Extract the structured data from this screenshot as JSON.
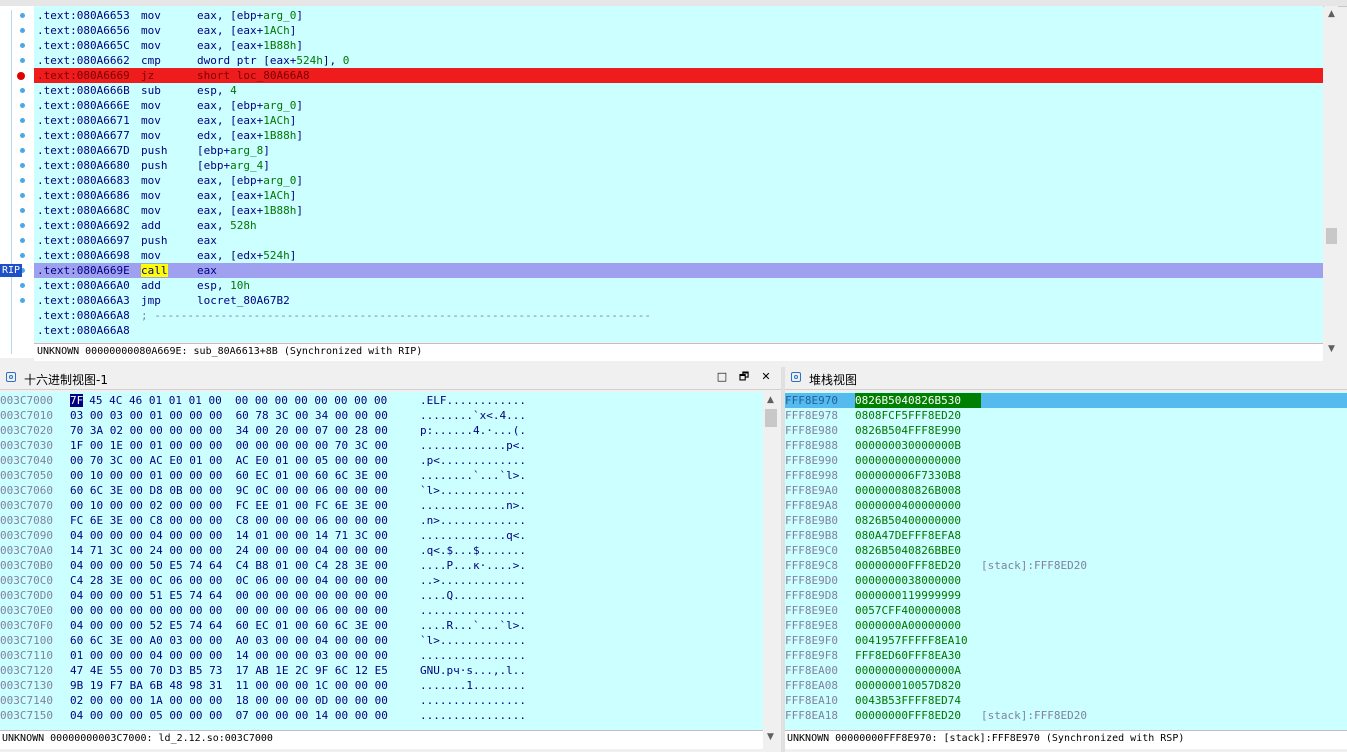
{
  "code_view": {
    "lines": [
      {
        "addr": ".text:080A6653",
        "mnem": "mov",
        "op": "eax, [ebp+arg_0]"
      },
      {
        "addr": ".text:080A6656",
        "mnem": "mov",
        "op": "eax, [eax+1ACh]"
      },
      {
        "addr": ".text:080A665C",
        "mnem": "mov",
        "op": "eax, [eax+1B88h]"
      },
      {
        "addr": ".text:080A6662",
        "mnem": "cmp",
        "op": "dword ptr [eax+524h], 0"
      },
      {
        "addr": ".text:080A6669",
        "mnem": "jz",
        "op": "short loc_80A66A8"
      },
      {
        "addr": ".text:080A666B",
        "mnem": "sub",
        "op": "esp, 4"
      },
      {
        "addr": ".text:080A666E",
        "mnem": "mov",
        "op": "eax, [ebp+arg_0]"
      },
      {
        "addr": ".text:080A6671",
        "mnem": "mov",
        "op": "eax, [eax+1ACh]"
      },
      {
        "addr": ".text:080A6677",
        "mnem": "mov",
        "op": "edx, [eax+1B88h]"
      },
      {
        "addr": ".text:080A667D",
        "mnem": "push",
        "op": "[ebp+arg_8]"
      },
      {
        "addr": ".text:080A6680",
        "mnem": "push",
        "op": "[ebp+arg_4]"
      },
      {
        "addr": ".text:080A6683",
        "mnem": "mov",
        "op": "eax, [ebp+arg_0]"
      },
      {
        "addr": ".text:080A6686",
        "mnem": "mov",
        "op": "eax, [eax+1ACh]"
      },
      {
        "addr": ".text:080A668C",
        "mnem": "mov",
        "op": "eax, [eax+1B88h]"
      },
      {
        "addr": ".text:080A6692",
        "mnem": "add",
        "op": "eax, 528h"
      },
      {
        "addr": ".text:080A6697",
        "mnem": "push",
        "op": "eax"
      },
      {
        "addr": ".text:080A6698",
        "mnem": "mov",
        "op": "eax, [edx+524h]"
      },
      {
        "addr": ".text:080A669E",
        "mnem": "call",
        "op": "eax"
      },
      {
        "addr": ".text:080A66A0",
        "mnem": "add",
        "op": "esp, 10h"
      },
      {
        "addr": ".text:080A66A3",
        "mnem": "jmp",
        "op": "locret_80A67B2"
      },
      {
        "addr": ".text:080A66A8",
        "mnem": "",
        "op": "",
        "comment": "; ---------------------------------------------------------------------------"
      },
      {
        "addr": ".text:080A66A8",
        "mnem": "",
        "op": ""
      }
    ],
    "rip_label": "RIP",
    "status": "UNKNOWN 00000000080A669E: sub_80A6613+8B (Synchronized with RIP)"
  },
  "hex_view": {
    "title": "十六进制视图-1",
    "rows": [
      {
        "addr": "003C7000",
        "bytes": "45 4C 46 01 01 01 00  00 00 00 00 00 00 00 00",
        "first": "7F",
        "ascii": ".ELF............"
      },
      {
        "addr": "003C7010",
        "bytes": "03 00 03 00 01 00 00 00  60 78 3C 00 34 00 00 00",
        "ascii": "........`x<.4..."
      },
      {
        "addr": "003C7020",
        "bytes": "70 3A 02 00 00 00 00 00  34 00 20 00 07 00 28 00",
        "ascii": "p:......4.·...(."
      },
      {
        "addr": "003C7030",
        "bytes": "1F 00 1E 00 01 00 00 00  00 00 00 00 00 70 3C 00",
        "ascii": ".............p<."
      },
      {
        "addr": "003C7040",
        "bytes": "00 70 3C 00 AC E0 01 00  AC E0 01 00 05 00 00 00",
        "ascii": ".p<............."
      },
      {
        "addr": "003C7050",
        "bytes": "00 10 00 00 01 00 00 00  60 EC 01 00 60 6C 3E 00",
        "ascii": "........`...`l>."
      },
      {
        "addr": "003C7060",
        "bytes": "60 6C 3E 00 D8 0B 00 00  9C 0C 00 00 06 00 00 00",
        "ascii": "`l>............."
      },
      {
        "addr": "003C7070",
        "bytes": "00 10 00 00 02 00 00 00  FC EE 01 00 FC 6E 3E 00",
        "ascii": ".............n>."
      },
      {
        "addr": "003C7080",
        "bytes": "FC 6E 3E 00 C8 00 00 00  C8 00 00 00 06 00 00 00",
        "ascii": ".n>............."
      },
      {
        "addr": "003C7090",
        "bytes": "04 00 00 00 04 00 00 00  14 01 00 00 14 71 3C 00",
        "ascii": ".............q<."
      },
      {
        "addr": "003C70A0",
        "bytes": "14 71 3C 00 24 00 00 00  24 00 00 00 04 00 00 00",
        "ascii": ".q<.$...$......."
      },
      {
        "addr": "003C70B0",
        "bytes": "04 00 00 00 50 E5 74 64  C4 B8 01 00 C4 28 3E 00",
        "ascii": "....P...к·....>."
      },
      {
        "addr": "003C70C0",
        "bytes": "C4 28 3E 00 0C 06 00 00  0C 06 00 00 04 00 00 00",
        "ascii": "..>............."
      },
      {
        "addr": "003C70D0",
        "bytes": "04 00 00 00 51 E5 74 64  00 00 00 00 00 00 00 00",
        "ascii": "....Q..........."
      },
      {
        "addr": "003C70E0",
        "bytes": "00 00 00 00 00 00 00 00  00 00 00 00 06 00 00 00",
        "ascii": "................"
      },
      {
        "addr": "003C70F0",
        "bytes": "04 00 00 00 52 E5 74 64  60 EC 01 00 60 6C 3E 00",
        "ascii": "....R...`...`l>."
      },
      {
        "addr": "003C7100",
        "bytes": "60 6C 3E 00 A0 03 00 00  A0 03 00 00 04 00 00 00",
        "ascii": "`l>............."
      },
      {
        "addr": "003C7110",
        "bytes": "01 00 00 00 04 00 00 00  14 00 00 00 03 00 00 00",
        "ascii": "................"
      },
      {
        "addr": "003C7120",
        "bytes": "47 4E 55 00 70 D3 B5 73  17 AB 1E 2C 9F 6C 12 E5",
        "ascii": "GNU.pч·s...,.l.."
      },
      {
        "addr": "003C7130",
        "bytes": "9B 19 F7 BA 6B 48 98 31  11 00 00 00 1C 00 00 00",
        "ascii": ".......1........"
      },
      {
        "addr": "003C7140",
        "bytes": "02 00 00 00 1A 00 00 00  18 00 00 00 0D 00 00 00",
        "ascii": "................"
      },
      {
        "addr": "003C7150",
        "bytes": "04 00 00 00 05 00 00 00  07 00 00 00 14 00 00 00",
        "ascii": "................"
      }
    ],
    "status": "UNKNOWN 00000000003C7000: ld_2.12.so:003C7000"
  },
  "stack_view": {
    "title": "堆栈视图",
    "rows": [
      {
        "addr": "FFF8E970",
        "val": "0826B5040826B530",
        "cmt": ""
      },
      {
        "addr": "FFF8E978",
        "val": "0808FCF5FFF8ED20",
        "cmt": ""
      },
      {
        "addr": "FFF8E980",
        "val": "0826B504FFF8E990",
        "cmt": ""
      },
      {
        "addr": "FFF8E988",
        "val": "000000030000000B",
        "cmt": ""
      },
      {
        "addr": "FFF8E990",
        "val": "0000000000000000",
        "cmt": ""
      },
      {
        "addr": "FFF8E998",
        "val": "000000006F7330B8",
        "cmt": ""
      },
      {
        "addr": "FFF8E9A0",
        "val": "000000080826B008",
        "cmt": ""
      },
      {
        "addr": "FFF8E9A8",
        "val": "0000000400000000",
        "cmt": ""
      },
      {
        "addr": "FFF8E9B0",
        "val": "0826B50400000000",
        "cmt": ""
      },
      {
        "addr": "FFF8E9B8",
        "val": "080A47DEFFF8EFA8",
        "cmt": ""
      },
      {
        "addr": "FFF8E9C0",
        "val": "0826B5040826BBE0",
        "cmt": ""
      },
      {
        "addr": "FFF8E9C8",
        "val": "00000000FFF8ED20",
        "cmt": "[stack]:FFF8ED20"
      },
      {
        "addr": "FFF8E9D0",
        "val": "0000000038000000",
        "cmt": ""
      },
      {
        "addr": "FFF8E9D8",
        "val": "0000000119999999",
        "cmt": ""
      },
      {
        "addr": "FFF8E9E0",
        "val": "0057CFF400000008",
        "cmt": ""
      },
      {
        "addr": "FFF8E9E8",
        "val": "0000000A00000000",
        "cmt": ""
      },
      {
        "addr": "FFF8E9F0",
        "val": "0041957FFFFF8EA10",
        "cmt": ""
      },
      {
        "addr": "FFF8E9F8",
        "val": "FFF8ED60FFF8EA30",
        "cmt": ""
      },
      {
        "addr": "FFF8EA00",
        "val": "000000000000000A",
        "cmt": ""
      },
      {
        "addr": "FFF8EA08",
        "val": "000000010057D820",
        "cmt": ""
      },
      {
        "addr": "FFF8EA10",
        "val": "0043B53FFFF8ED74",
        "cmt": ""
      },
      {
        "addr": "FFF8EA18",
        "val": "00000000FFF8ED20",
        "cmt": "[stack]:FFF8ED20"
      }
    ],
    "status": "UNKNOWN 00000000FFF8E970: [stack]:FFF8E970 (Synchronized with RSP)"
  },
  "panel_buttons": {
    "minimize": "□",
    "restore": "🗗",
    "close": "✕"
  },
  "icons": [
    "breakpoint-icon",
    "panel-icon",
    "scroll-up-icon",
    "scroll-down-icon"
  ]
}
